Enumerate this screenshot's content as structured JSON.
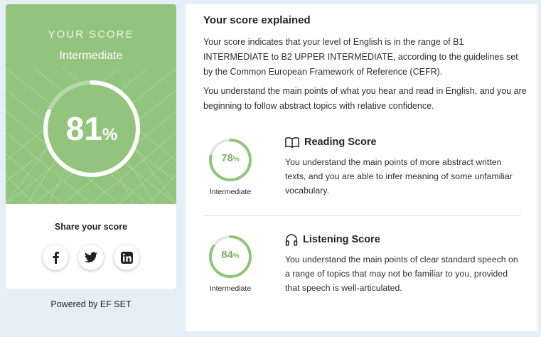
{
  "score_card": {
    "heading": "YOUR SCORE",
    "level": "Intermediate",
    "score": "81",
    "score_unit": "%",
    "score_fraction": 0.81,
    "hero_color": "#93c47d",
    "share_title": "Share your score",
    "share_icons": [
      "facebook-icon",
      "twitter-icon",
      "linkedin-icon"
    ]
  },
  "powered_by": "Powered by EF SET",
  "explanation": {
    "title": "Your score explained",
    "paragraph1": "Your score indicates that your level of English is in the range of B1 INTERMEDIATE to B2 UPPER INTERMEDIATE, according to the guidelines set by the Common European Framework of Reference (CEFR).",
    "paragraph2": "You understand the main points of what you hear and read in English, and you are beginning to follow abstract topics with relative confidence."
  },
  "reading": {
    "icon": "book-icon",
    "title": "Reading Score",
    "score": "78",
    "unit": "%",
    "fraction": 0.78,
    "level": "Intermediate",
    "description": "You understand the main points of more abstract written texts, and you are able to infer meaning of some unfamiliar vocabulary."
  },
  "listening": {
    "icon": "headphones-icon",
    "title": "Listening Score",
    "score": "84",
    "unit": "%",
    "fraction": 0.84,
    "level": "Intermediate",
    "description": "You understand the main points of clear standard speech on a range of topics that may not be familiar to you, provided that speech is well-articulated."
  },
  "colors": {
    "accent_green": "#93c47d",
    "ring_green": "#7fb06a"
  }
}
